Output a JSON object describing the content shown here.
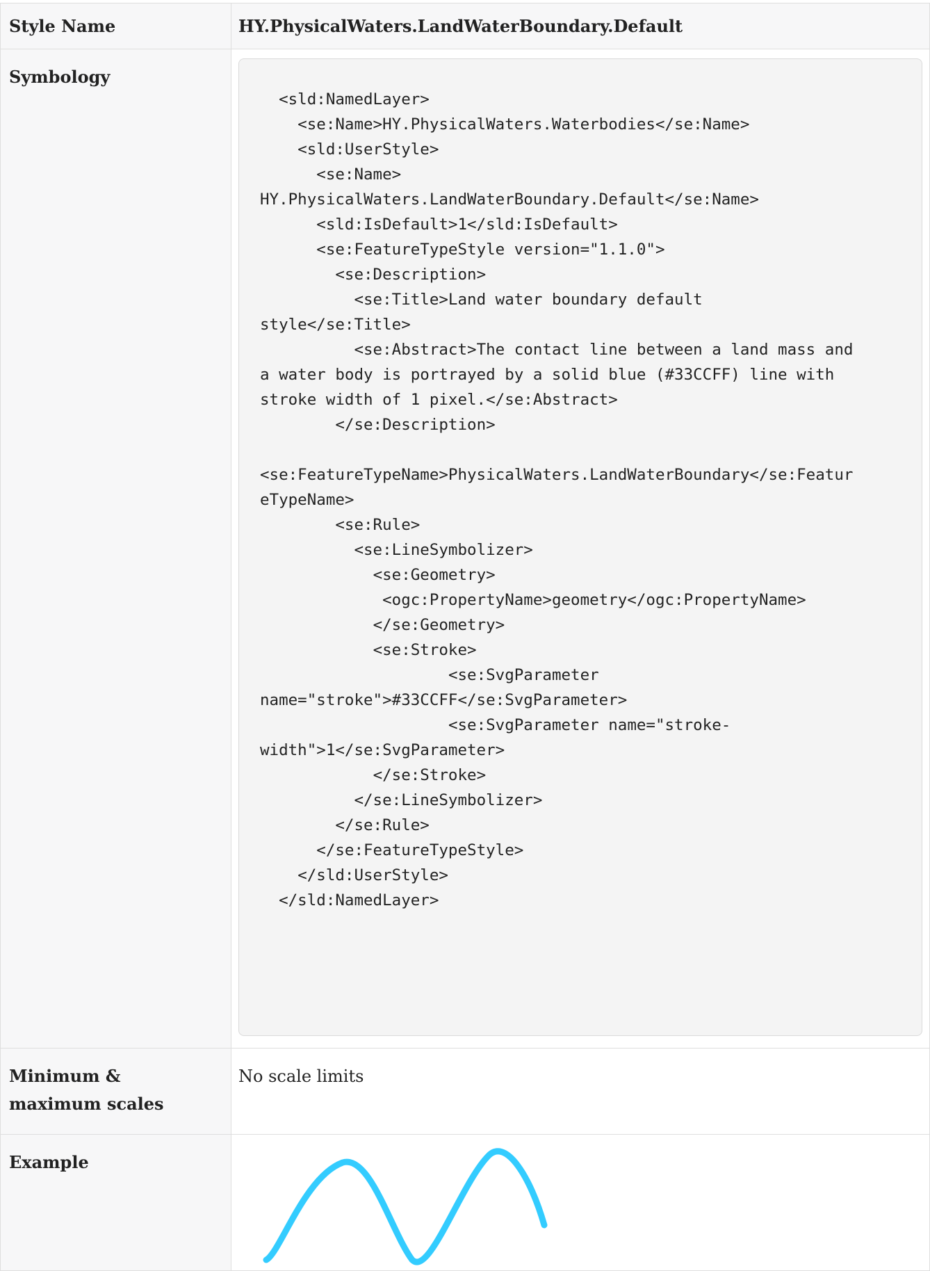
{
  "table": {
    "header": {
      "label": "Style Name",
      "value": "HY.PhysicalWaters.LandWaterBoundary.Default"
    },
    "symbology": {
      "label": "Symbology",
      "code": "  <sld:NamedLayer>\n    <se:Name>HY.PhysicalWaters.Waterbodies</se:Name>\n    <sld:UserStyle>\n      <se:Name>\nHY.PhysicalWaters.LandWaterBoundary.Default</se:Name>\n      <sld:IsDefault>1</sld:IsDefault>\n      <se:FeatureTypeStyle version=\"1.1.0\">\n        <se:Description>\n          <se:Title>Land water boundary default\nstyle</se:Title>\n          <se:Abstract>The contact line between a land mass and\na water body is portrayed by a solid blue (#33CCFF) line with\nstroke width of 1 pixel.</se:Abstract>\n        </se:Description>\n\n<se:FeatureTypeName>PhysicalWaters.LandWaterBoundary</se:Featur\neTypeName>\n        <se:Rule>\n          <se:LineSymbolizer>\n            <se:Geometry>\n             <ogc:PropertyName>geometry</ogc:PropertyName>\n            </se:Geometry>\n            <se:Stroke>\n                    <se:SvgParameter\nname=\"stroke\">#33CCFF</se:SvgParameter>\n                    <se:SvgParameter name=\"stroke-\nwidth\">1</se:SvgParameter>\n            </se:Stroke>\n          </se:LineSymbolizer>\n        </se:Rule>\n      </se:FeatureTypeStyle>\n    </sld:UserStyle>\n  </sld:NamedLayer>"
    },
    "scales": {
      "label_line1": "Minimum &",
      "label_line2": "maximum scales",
      "value": "No scale limits"
    },
    "example": {
      "label": "Example",
      "stroke_color": "#33CCFF"
    }
  }
}
